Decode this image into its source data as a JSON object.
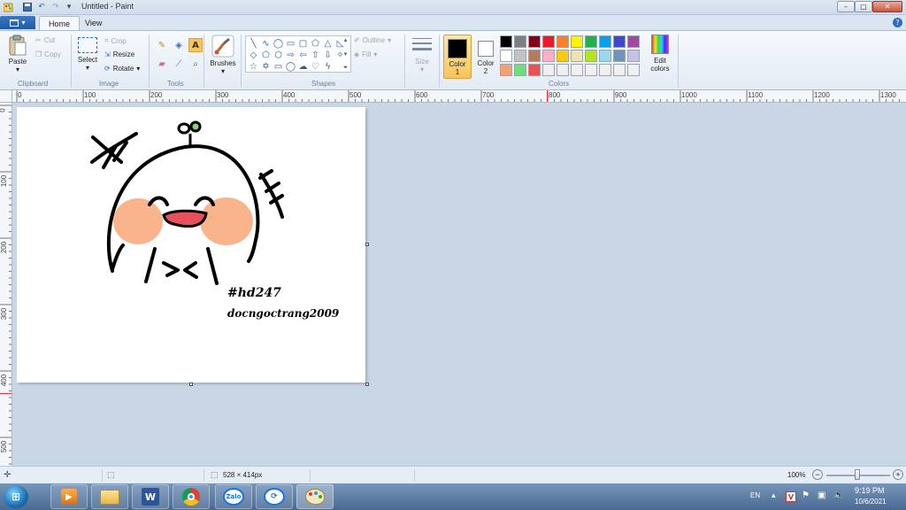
{
  "window": {
    "title": "Untitled - Paint",
    "controls": {
      "minimize": "–",
      "maximize": "□",
      "close": "✕"
    }
  },
  "quick_access": [
    "paint-app-icon",
    "save-icon",
    "undo-icon",
    "redo-icon",
    "customize-qat-icon"
  ],
  "tabs": [
    {
      "label": "Home"
    },
    {
      "label": "View"
    }
  ],
  "ribbon": {
    "clipboard": {
      "paste": "Paste",
      "cut": "Cut",
      "copy": "Copy",
      "group": "Clipboard"
    },
    "image": {
      "select": "Select",
      "crop": "Crop",
      "resize": "Resize",
      "rotate": "Rotate",
      "group": "Image"
    },
    "tools": {
      "group": "Tools"
    },
    "brushes": {
      "label": "Brushes"
    },
    "shapes": {
      "outline": "Outline",
      "fill": "Fill",
      "group": "Shapes"
    },
    "size": {
      "label": "Size"
    },
    "colors": {
      "color1": "Color\n1",
      "color1_line1": "Color",
      "color1_line2": "1",
      "color2_line1": "Color",
      "color2_line2": "2",
      "edit_line1": "Edit",
      "edit_line2": "colors",
      "group": "Colors",
      "color1_value": "#000000",
      "color2_value": "#ffffff",
      "palette": [
        "#000000",
        "#7f7f7f",
        "#880015",
        "#ed1c24",
        "#ff7f27",
        "#fff200",
        "#22b14c",
        "#00a2e8",
        "#3f48cc",
        "#a349a4",
        "#ffffff",
        "#c3c3c3",
        "#b97a57",
        "#ffaec9",
        "#ffc90e",
        "#efe4b0",
        "#b5e61d",
        "#99d9ea",
        "#7092be",
        "#c8bfe7",
        "#f4a070",
        "#6ede7d",
        "#ee5050",
        "#f0f0f0",
        "#f0f0f0",
        "#f0f0f0",
        "#f0f0f0",
        "#f0f0f0",
        "#f0f0f0",
        "#f0f0f0"
      ]
    }
  },
  "ruler": {
    "top": [
      "0",
      "100",
      "200",
      "300",
      "400",
      "500",
      "600",
      "700",
      "800",
      "900",
      "1000",
      "1100",
      "1200",
      "1300"
    ],
    "left": [
      "0",
      "100",
      "200",
      "300",
      "400",
      "500"
    ]
  },
  "canvas_text": {
    "hashtag": "#hd247",
    "signature": "docngoctrang2009"
  },
  "status": {
    "size": "528 × 414px",
    "zoom": "100%"
  },
  "taskbar": {
    "language": "EN",
    "time": "9:19 PM",
    "date": "10/6/2021",
    "zalo": "Zalo"
  }
}
